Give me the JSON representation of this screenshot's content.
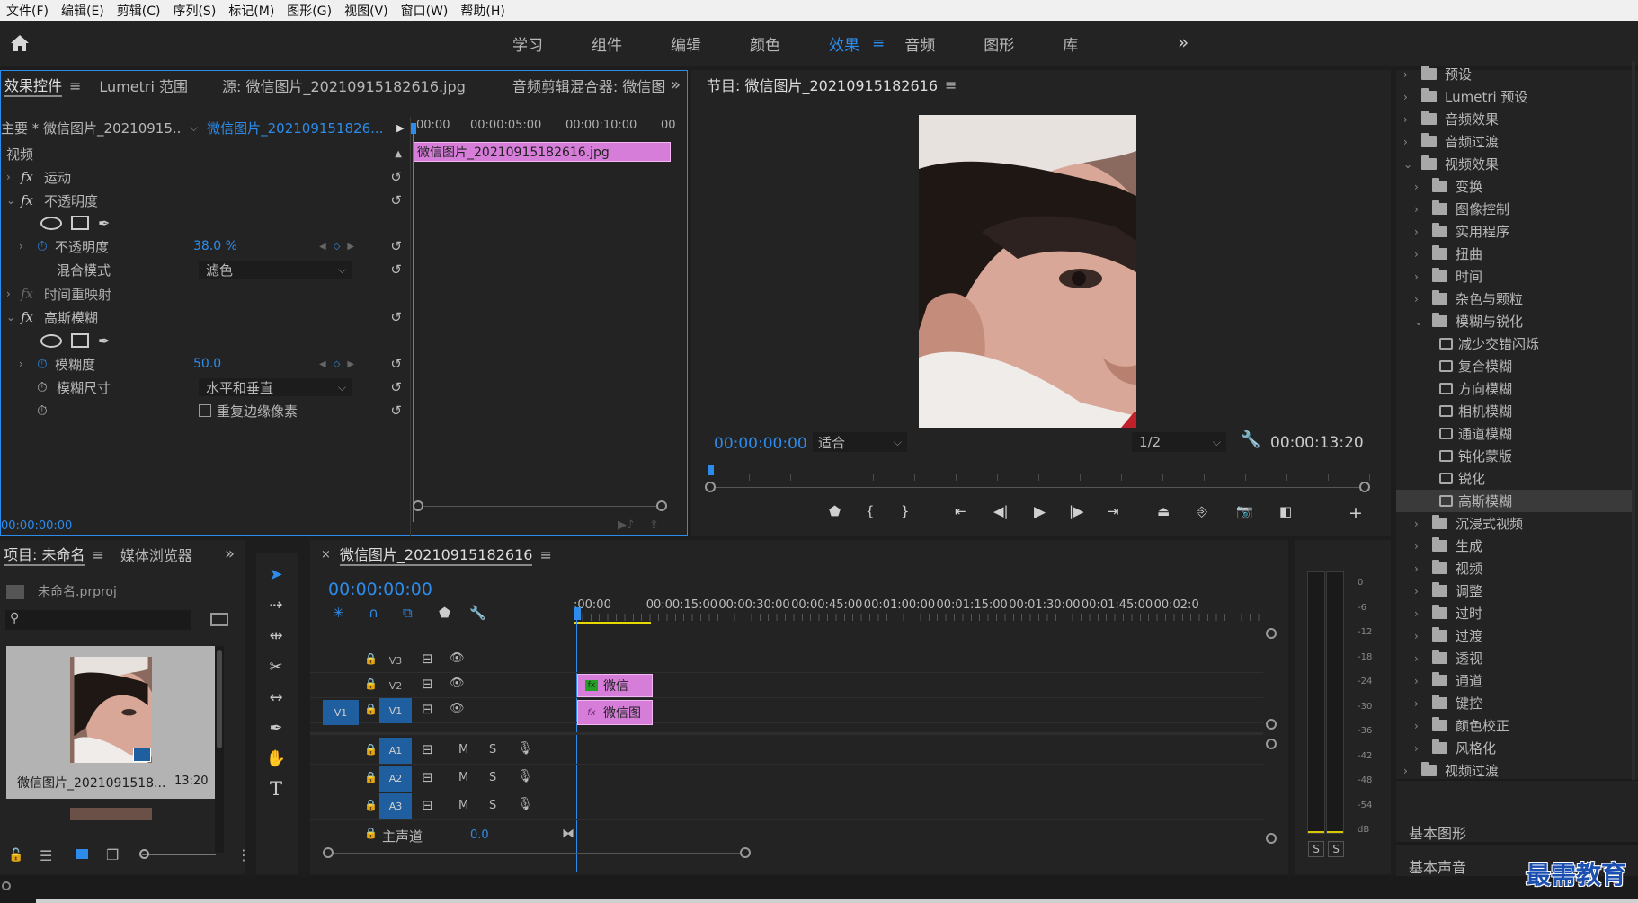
{
  "menu": [
    "文件(F)",
    "编辑(E)",
    "剪辑(C)",
    "序列(S)",
    "标记(M)",
    "图形(G)",
    "视图(V)",
    "窗口(W)",
    "帮助(H)"
  ],
  "workspaces": [
    "学习",
    "组件",
    "编辑",
    "颜色",
    "效果",
    "音频",
    "图形",
    "库"
  ],
  "active_workspace": "效果",
  "effect_controls": {
    "tabs": [
      "效果控件",
      "Lumetri 范围",
      "源: 微信图片_20210915182616.jpg",
      "音频剪辑混合器: 微信图"
    ],
    "master_label": "主要 * 微信图片_20210915...",
    "clip_label": "微信图片_202109151826...",
    "timecodes": [
      "00:00",
      "00:00:05:00",
      "00:00:10:00",
      "00"
    ],
    "clip_bar": "微信图片_20210915182616.jpg",
    "video_label": "视频",
    "motion": "运动",
    "opacity_group": "不透明度",
    "opacity_param": "不透明度",
    "opacity_value": "38.0 %",
    "blend_label": "混合模式",
    "blend_value": "滤色",
    "time_remap": "时间重映射",
    "gaussian": "高斯模糊",
    "blur_label": "模糊度",
    "blur_value": "50.0",
    "blur_dim_label": "模糊尺寸",
    "blur_dim_value": "水平和垂直",
    "repeat_edge": "重复边缘像素",
    "footer_tc": "00:00:00:00"
  },
  "program": {
    "title": "节目: 微信图片_20210915182616",
    "timecode": "00:00:00:00",
    "fit": "适合",
    "resolution": "1/2",
    "duration": "00:00:13:20"
  },
  "effects_tree": {
    "items": [
      {
        "label": "预设",
        "level": 0,
        "type": "folder",
        "open": false
      },
      {
        "label": "Lumetri 预设",
        "level": 0,
        "type": "folder",
        "open": false
      },
      {
        "label": "音频效果",
        "level": 0,
        "type": "folder",
        "open": false
      },
      {
        "label": "音频过渡",
        "level": 0,
        "type": "folder",
        "open": false
      },
      {
        "label": "视频效果",
        "level": 0,
        "type": "folder",
        "open": true
      },
      {
        "label": "变换",
        "level": 1,
        "type": "folder",
        "open": false
      },
      {
        "label": "图像控制",
        "level": 1,
        "type": "folder",
        "open": false
      },
      {
        "label": "实用程序",
        "level": 1,
        "type": "folder",
        "open": false
      },
      {
        "label": "扭曲",
        "level": 1,
        "type": "folder",
        "open": false
      },
      {
        "label": "时间",
        "level": 1,
        "type": "folder",
        "open": false
      },
      {
        "label": "杂色与颗粒",
        "level": 1,
        "type": "folder",
        "open": false
      },
      {
        "label": "模糊与锐化",
        "level": 1,
        "type": "folder",
        "open": true
      },
      {
        "label": "减少交错闪烁",
        "level": 2,
        "type": "effect"
      },
      {
        "label": "复合模糊",
        "level": 2,
        "type": "effect"
      },
      {
        "label": "方向模糊",
        "level": 2,
        "type": "effect"
      },
      {
        "label": "相机模糊",
        "level": 2,
        "type": "effect"
      },
      {
        "label": "通道模糊",
        "level": 2,
        "type": "effect"
      },
      {
        "label": "钝化蒙版",
        "level": 2,
        "type": "effect"
      },
      {
        "label": "锐化",
        "level": 2,
        "type": "effect"
      },
      {
        "label": "高斯模糊",
        "level": 2,
        "type": "effect",
        "selected": true
      },
      {
        "label": "沉浸式视频",
        "level": 1,
        "type": "folder",
        "open": false
      },
      {
        "label": "生成",
        "level": 1,
        "type": "folder",
        "open": false
      },
      {
        "label": "视频",
        "level": 1,
        "type": "folder",
        "open": false
      },
      {
        "label": "调整",
        "level": 1,
        "type": "folder",
        "open": false
      },
      {
        "label": "过时",
        "level": 1,
        "type": "folder",
        "open": false
      },
      {
        "label": "过渡",
        "level": 1,
        "type": "folder",
        "open": false
      },
      {
        "label": "透视",
        "level": 1,
        "type": "folder",
        "open": false
      },
      {
        "label": "通道",
        "level": 1,
        "type": "folder",
        "open": false
      },
      {
        "label": "键控",
        "level": 1,
        "type": "folder",
        "open": false
      },
      {
        "label": "颜色校正",
        "level": 1,
        "type": "folder",
        "open": false
      },
      {
        "label": "风格化",
        "level": 1,
        "type": "folder",
        "open": false
      },
      {
        "label": "视频过渡",
        "level": 0,
        "type": "folder",
        "open": false
      }
    ],
    "basic_graphics": "基本图形",
    "basic_sound": "基本声音"
  },
  "project": {
    "tab1": "项目: 未命名",
    "tab2": "媒体浏览器",
    "file": "未命名.prproj",
    "item_name": "微信图片_2021091518...",
    "item_duration": "13:20"
  },
  "timeline": {
    "title": "微信图片_20210915182616",
    "timecode": "00:00:00:00",
    "ruler": [
      ":00:00",
      "00:00:15:00",
      "00:00:30:00",
      "00:00:45:00",
      "00:01:00:00",
      "00:01:15:00",
      "00:01:30:00",
      "00:01:45:00",
      "00:02:0"
    ],
    "video_tracks": [
      "V3",
      "V2",
      "V1"
    ],
    "audio_tracks": [
      "A1",
      "A2",
      "A3"
    ],
    "source_patch": "V1",
    "master": "主声道",
    "master_value": "0.0",
    "clip_v2": "微信",
    "clip_v1": "微信图"
  },
  "meter": {
    "scale": [
      "0",
      "-6",
      "-12",
      "-18",
      "-24",
      "-30",
      "-36",
      "-42",
      "-48",
      "-54",
      "dB"
    ],
    "solo": [
      "S",
      "S"
    ]
  },
  "audio_buttons": {
    "mute": "M",
    "solo": "S"
  },
  "watermark": "最需教育",
  "colors": {
    "accent": "#2d8ceb",
    "clip": "#d67dd9",
    "panel": "#232323"
  }
}
